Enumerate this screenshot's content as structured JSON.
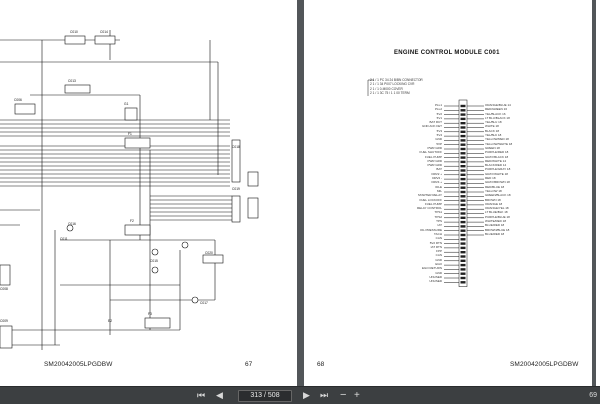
{
  "viewer": {
    "page_indicator": "313 / 508",
    "zoom": "69",
    "toolbar_icons": [
      "first-page-icon",
      "prev-page-icon",
      "next-page-icon",
      "last-page-icon",
      "zoom-out-icon",
      "zoom-in-icon"
    ]
  },
  "left_page": {
    "footer_code": "SM20042005LPGDBW",
    "page_number": "67",
    "connector_labels": [
      "C010",
      "C014",
      "C013",
      "C006",
      "G1",
      "F1",
      "C018",
      "C019",
      "C016",
      "F2",
      "C011",
      "C015",
      "C008",
      "C009",
      "C017",
      "F3",
      "E2",
      "C020"
    ]
  },
  "right_page": {
    "page_number": "68",
    "footer_code": "SM20042005LPGDBW",
    "title": "ENGINE CONTROL MODULE C001",
    "notes": [
      "2 1 / 1 PC 34 24 B/BN CONNECTOR",
      "2 1 / 1 34 P007 LOCKING CVR",
      "2 1 / 1 0-M000 COVER",
      "2 1 / 1 3C 75 / 1 1 00 TERM"
    ],
    "pin_labels": [
      "PLL1",
      "PLL2",
      "5V2",
      "5V1",
      "BAT RCT",
      "GND ACK FET",
      "5V3",
      "5V4",
      "GND",
      "5VP",
      "PWR GRD",
      "FUEL SHUTOFF",
      "FUEL PUMP",
      "PWR GRD",
      "PWR GRD",
      "BAT",
      "DRV2 +",
      "DRV2 -",
      "DRV4 +",
      "IDLE",
      "MIL",
      "STARTER RELAY",
      "FUEL LOCKOFF",
      "FUEL PUMP",
      "RELAY CONTROL",
      "TPS1",
      "TPS2",
      "TPS",
      "IAT",
      "OIL PRESSURE",
      "TACH",
      "CAN",
      "5V2 RTN",
      "IAT RTN",
      "FPP",
      "CAN",
      "GND",
      "EGO",
      "EGO RETURN",
      "GND",
      "UNUSED",
      "UNUSED"
    ],
    "wire_labels": [
      "ORANGE/BLUE 14",
      "RED/GREEN 16",
      "YEL/BLACK 16",
      "LT BLU/BLACK 18",
      "YEL/BLU 18",
      "WHITE 18",
      "BLACK 18",
      "YEL/BLK 18",
      "YELLOW/RED 18",
      "YELLOW/WHITE 18",
      "GREEN 18",
      "PURPLE/RED 18",
      "GRAY/BLACK 18",
      "RED/WHITE 14",
      "BLACK/RED 14",
      "PURPLE/GRAY 18",
      "GRAY/WHITE 18",
      "RED 18",
      "GRAY/BROWN 18",
      "RED/BLUE 18",
      "YELLOW 18",
      "GREEN/BLACK 18",
      "BROWN 18",
      "ORANGE 18",
      "ORANGE/YEL 18",
      "LT BLUE/BLK 18",
      "PURPLE/BLUE 18",
      "WHITE/RED 18",
      "BLUE/RED 18",
      "BROWN/BLUE 18",
      "BLUE/RED 18"
    ]
  }
}
